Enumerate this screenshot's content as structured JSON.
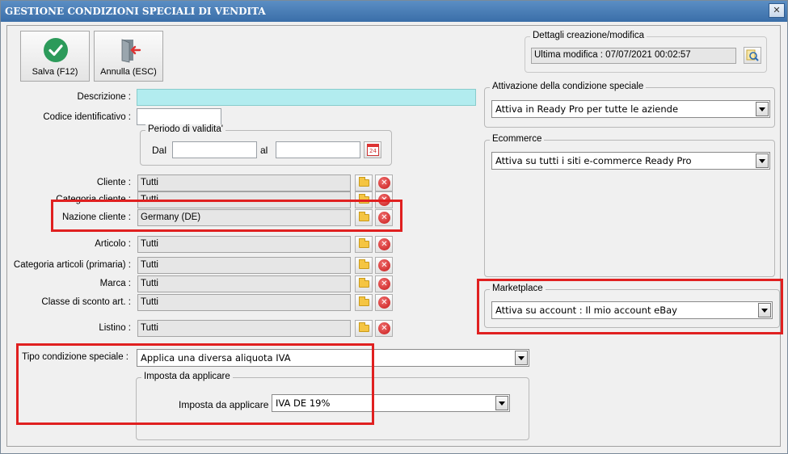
{
  "window": {
    "title": "GESTIONE CONDIZIONI SPECIALI DI VENDITA",
    "close_glyph": "✕"
  },
  "toolbar": {
    "save_label": "Salva (F12)",
    "save_icon": "check-circle-icon",
    "cancel_label": "Annulla (ESC)",
    "cancel_icon": "exit-door-icon"
  },
  "form": {
    "descrizione_label": "Descrizione :",
    "descrizione_value": "",
    "codice_label": "Codice identificativo :",
    "codice_value": "",
    "periodo": {
      "title": "Periodo di validita'",
      "dal_label": "Dal",
      "al_label": "al",
      "dal_value": "",
      "al_value": "",
      "calendar_day": "24"
    },
    "fields": [
      {
        "label": "Cliente :",
        "value": "Tutti"
      },
      {
        "label": "Categoria cliente :",
        "value": "Tutti"
      },
      {
        "label": "Nazione cliente :",
        "value": "Germany (DE)"
      },
      {
        "label": "Articolo :",
        "value": "Tutti"
      },
      {
        "label": "Categoria articoli (primaria) :",
        "value": "Tutti"
      },
      {
        "label": "Marca :",
        "value": "Tutti"
      },
      {
        "label": "Classe di sconto art. :",
        "value": "Tutti"
      },
      {
        "label": "Listino :",
        "value": "Tutti"
      }
    ],
    "tipo_label": "Tipo condizione speciale :",
    "tipo_value": "Applica una diversa aliquota IVA",
    "imposta_group_title": "Imposta da applicare",
    "imposta_label": "Imposta da applicare :",
    "imposta_value": "IVA DE 19%"
  },
  "right": {
    "dettagli_title": "Dettagli creazione/modifica",
    "ultima_modifica": "Ultima modifica : 07/07/2021  00:02:57",
    "attivazione_title": "Attivazione della condizione speciale",
    "attivazione_value": "Attiva in Ready Pro per tutte le aziende",
    "ecommerce_title": "Ecommerce",
    "ecommerce_value": "Attiva su tutti i siti e-commerce Ready Pro",
    "marketplace_title": "Marketplace",
    "marketplace_value": "Attiva su account : Il mio account eBay"
  },
  "colors": {
    "highlight": "#e02020",
    "active_input": "#b2ecef",
    "titlebar": "#3a6ea8"
  }
}
